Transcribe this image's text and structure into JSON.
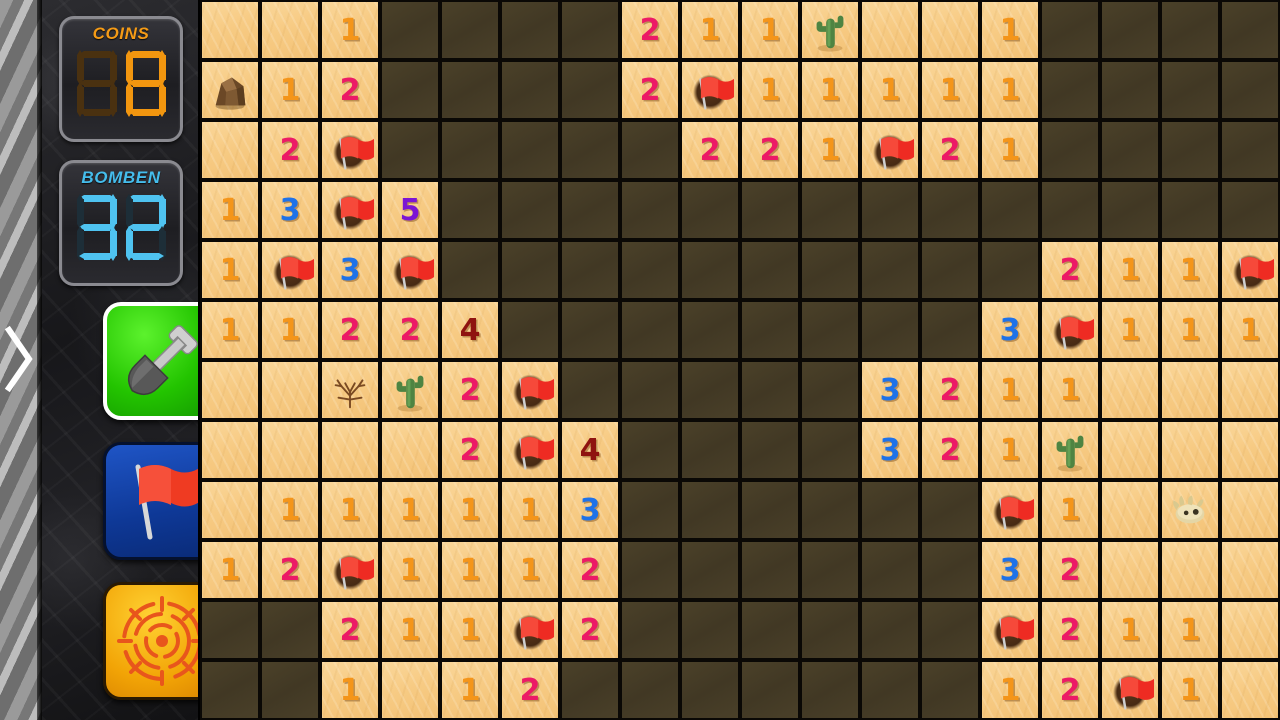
{
  "game": {
    "title": "Minesweeper Desert",
    "theme_colors": {
      "sand": "#f7cb84",
      "hidden": "#443a25",
      "flag_red": "#ee2b22",
      "n1": "#f4951a",
      "n2": "#ec1a66",
      "n3": "#1f72e8",
      "n4": "#8f1310",
      "n5": "#7b14d4"
    }
  },
  "hud": {
    "coins": {
      "label": "COINS",
      "value": "8",
      "digits": [
        "off",
        "8"
      ],
      "color": "#f2960f"
    },
    "bombs": {
      "label": "BOMBEN",
      "value": "32",
      "digits": [
        "3",
        "2"
      ],
      "color": "#4fc3f0"
    }
  },
  "tools": [
    {
      "id": "shovel",
      "icon": "shovel-icon",
      "name": "dig-tool",
      "selected": true,
      "bg": "#23c400"
    },
    {
      "id": "flag",
      "icon": "flag-icon",
      "name": "flag-tool",
      "selected": false,
      "bg": "#0e3896"
    },
    {
      "id": "detector",
      "icon": "detector-icon",
      "name": "detector-tool",
      "selected": false,
      "bg": "#f2a406"
    }
  ],
  "nav": {
    "expand_icon": "chevron-right-icon"
  },
  "board": {
    "columns": 18,
    "rows": 12,
    "cell_size": 60,
    "legend": {
      "h": "hidden",
      "e": "empty-open",
      "F": "flag",
      "C": "cactus",
      "B": "dead-bush",
      "R": "rock",
      "S": "skull"
    },
    "grid": [
      [
        "e",
        "e",
        "1",
        "h",
        "h",
        "h",
        "h",
        "2",
        "1",
        "1",
        "C",
        "e",
        "e",
        "1",
        "h",
        "h",
        "h",
        "h"
      ],
      [
        "R",
        "1",
        "2",
        "h",
        "h",
        "h",
        "h",
        "2",
        "F",
        "1",
        "1",
        "1",
        "1",
        "1",
        "h",
        "h",
        "h",
        "h"
      ],
      [
        "e",
        "2",
        "F",
        "h",
        "h",
        "h",
        "h",
        "h",
        "2",
        "2",
        "1",
        "F",
        "2",
        "1",
        "h",
        "h",
        "h",
        "h"
      ],
      [
        "1",
        "3",
        "F",
        "5",
        "h",
        "h",
        "h",
        "h",
        "h",
        "h",
        "h",
        "h",
        "h",
        "h",
        "h",
        "h",
        "h",
        "h"
      ],
      [
        "1",
        "F",
        "3",
        "F",
        "h",
        "h",
        "h",
        "h",
        "h",
        "h",
        "h",
        "h",
        "h",
        "h",
        "2",
        "1",
        "1",
        "F"
      ],
      [
        "1",
        "1",
        "2",
        "2",
        "4",
        "h",
        "h",
        "h",
        "h",
        "h",
        "h",
        "h",
        "h",
        "3",
        "F",
        "1",
        "1",
        "1"
      ],
      [
        "e",
        "e",
        "B",
        "C",
        "2",
        "F",
        "h",
        "h",
        "h",
        "h",
        "h",
        "3",
        "2",
        "1",
        "1",
        "e",
        "e",
        "e"
      ],
      [
        "e",
        "e",
        "e",
        "e",
        "2",
        "F",
        "4",
        "h",
        "h",
        "h",
        "h",
        "3",
        "2",
        "1",
        "C",
        "e",
        "e",
        "e"
      ],
      [
        "e",
        "1",
        "1",
        "1",
        "1",
        "1",
        "3",
        "h",
        "h",
        "h",
        "h",
        "h",
        "h",
        "F",
        "1",
        "e",
        "S",
        "e"
      ],
      [
        "1",
        "2",
        "F",
        "1",
        "1",
        "1",
        "2",
        "h",
        "h",
        "h",
        "h",
        "h",
        "h",
        "3",
        "2",
        "e",
        "e",
        "e"
      ],
      [
        "h",
        "h",
        "2",
        "1",
        "1",
        "F",
        "2",
        "h",
        "h",
        "h",
        "h",
        "h",
        "h",
        "F",
        "2",
        "1",
        "1",
        "e"
      ],
      [
        "h",
        "h",
        "1",
        "e",
        "1",
        "2",
        "h",
        "h",
        "h",
        "h",
        "h",
        "h",
        "h",
        "1",
        "2",
        "F",
        "1",
        "e"
      ]
    ]
  }
}
